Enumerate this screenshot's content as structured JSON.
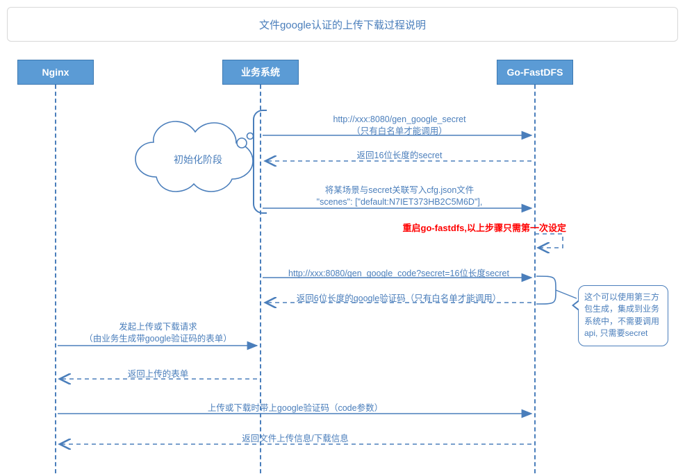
{
  "title": "文件google认证的上传下载过程说明",
  "actors": {
    "nginx": "Nginx",
    "biz": "业务系统",
    "go": "Go-FastDFS"
  },
  "cloud_label": "初始化阶段",
  "init_bracket_note": "",
  "messages": {
    "m1": "http://xxx:8080/gen_google_secret\n（只有白名单才能调用）",
    "m2": "返回16位长度的secret",
    "m3": "将某场景与secret关联写入cfg.json文件\n\"scenes\": [\"default:N7IET373HB2C5M6D\"],",
    "m4": "重启go-fastdfs,以上步骤只需第一次设定",
    "m5": "http://xxx:8080/gen_google_code?secret=16位长度secret",
    "m6": "返回6位长度的google验证码（只有白名单才能调用）",
    "m7": "发起上传或下载请求\n（由业务生成带google验证码的表单）",
    "m8": "返回上传的表单",
    "m9": "上传或下载时带上google验证码（code参数）",
    "m10": "返回文件上传信息/下载信息"
  },
  "side_note": "这个可以使用第三方包生成，集成到业务系统中，不需要调用api, 只需要secret",
  "colors": {
    "primary": "#4a7ebb",
    "actor_fill": "#5b9bd5",
    "alert": "#ff0000"
  },
  "chart_data": {
    "type": "sequence-diagram",
    "title": "文件google认证的上传下载过程说明",
    "participants": [
      "Nginx",
      "业务系统",
      "Go-FastDFS"
    ],
    "groups": [
      {
        "label": "初始化阶段",
        "messages": [
          {
            "from": "业务系统",
            "to": "Go-FastDFS",
            "kind": "solid",
            "text": "http://xxx:8080/gen_google_secret（只有白名单才能调用）"
          },
          {
            "from": "Go-FastDFS",
            "to": "业务系统",
            "kind": "dashed",
            "text": "返回16位长度的secret"
          },
          {
            "from": "业务系统",
            "to": "Go-FastDFS",
            "kind": "solid",
            "text": "将某场景与secret关联写入cfg.json文件 \"scenes\": [\"default:N7IET373HB2C5M6D\"]"
          }
        ]
      }
    ],
    "messages": [
      {
        "from": "Go-FastDFS",
        "to": "Go-FastDFS",
        "kind": "self-dashed",
        "text": "重启go-fastdfs,以上步骤只需第一次设定",
        "color": "#ff0000"
      },
      {
        "from": "业务系统",
        "to": "Go-FastDFS",
        "kind": "solid",
        "text": "http://xxx:8080/gen_google_code?secret=16位长度secret"
      },
      {
        "from": "Go-FastDFS",
        "to": "业务系统",
        "kind": "dashed",
        "text": "返回6位长度的google验证码（只有白名单才能调用）",
        "note": "这个可以使用第三方包生成，集成到业务系统中，不需要调用api, 只需要secret"
      },
      {
        "from": "Nginx",
        "to": "业务系统",
        "kind": "solid",
        "text": "发起上传或下载请求（由业务生成带google验证码的表单）"
      },
      {
        "from": "业务系统",
        "to": "Nginx",
        "kind": "dashed",
        "text": "返回上传的表单"
      },
      {
        "from": "Nginx",
        "to": "Go-FastDFS",
        "kind": "solid",
        "text": "上传或下载时带上google验证码（code参数）"
      },
      {
        "from": "Go-FastDFS",
        "to": "Nginx",
        "kind": "dashed",
        "text": "返回文件上传信息/下载信息"
      }
    ]
  }
}
